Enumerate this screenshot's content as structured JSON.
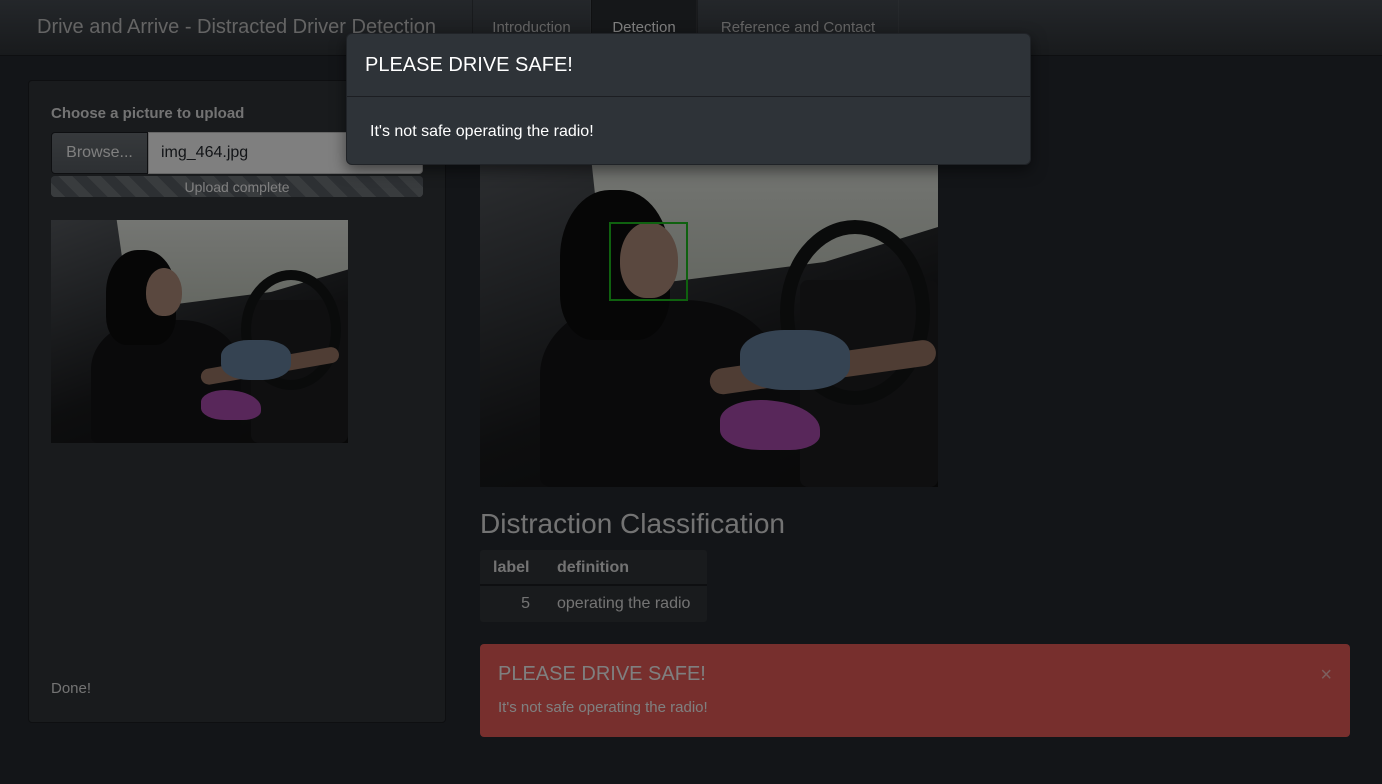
{
  "navbar": {
    "brand": "Drive and Arrive - Distracted Driver Detection",
    "tabs": [
      {
        "label": "Introduction",
        "active": false
      },
      {
        "label": "Detection",
        "active": true
      },
      {
        "label": "Reference and Contact",
        "active": false
      }
    ]
  },
  "sidebar": {
    "upload_label": "Choose a picture to upload",
    "browse_label": "Browse...",
    "file_name": "img_464.jpg",
    "progress_text": "Upload complete",
    "progress_fraction": 1.0,
    "status_text": "Done!"
  },
  "main": {
    "section_title": "Distraction Classification",
    "table": {
      "headers": [
        "label",
        "definition"
      ],
      "rows": [
        [
          "5",
          "operating the radio"
        ]
      ]
    },
    "alert": {
      "title": "PLEASE DRIVE SAFE!",
      "message": "It's not safe operating the radio!",
      "close": "×",
      "color": "#ee5f5b"
    },
    "face_box_color": "#1fc21f"
  },
  "modal": {
    "title": "PLEASE DRIVE SAFE!",
    "message": "It's not safe operating the radio!"
  },
  "theme": {
    "background": "#272b30",
    "navbar": "#3a3f44",
    "well": "#32363a"
  }
}
